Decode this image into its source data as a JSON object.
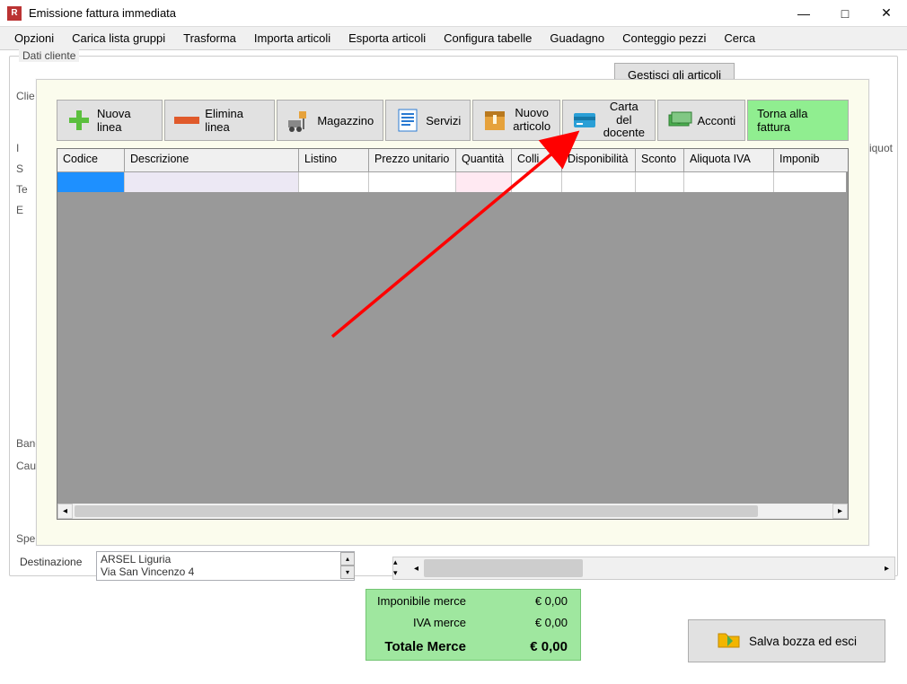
{
  "window": {
    "title": "Emissione fattura immediata",
    "app_icon_text": "R"
  },
  "menu": {
    "items": [
      "Opzioni",
      "Carica lista gruppi",
      "Trasforma",
      "Importa articoli",
      "Esporta articoli",
      "Configura tabelle",
      "Guadagno",
      "Conteggio pezzi",
      "Cerca"
    ]
  },
  "bg": {
    "group_title": "Dati cliente",
    "labels": {
      "clie": "Clie",
      "i": "I",
      "s": "S",
      "te": "Te",
      "e": "E",
      "banca": "Banca",
      "caus": "Caus",
      "spe": "Spe",
      "aliquot": "Aliquot"
    },
    "gestisci": "Gestisci gli articoli",
    "dest_label": "Destinazione",
    "dest_line1": "ARSEL Liguria",
    "dest_line2": "Via San Vincenzo 4"
  },
  "toolbar": {
    "nuova_linea": "Nuova linea",
    "elimina_linea": "Elimina linea",
    "magazzino": "Magazzino",
    "servizi": "Servizi",
    "nuovo_articolo": "Nuovo\narticolo",
    "carta_docente": "Carta del\ndocente",
    "acconti": "Acconti",
    "torna": "Torna alla fattura"
  },
  "grid": {
    "headers": [
      "Codice",
      "Descrizione",
      "Listino",
      "Prezzo unitario",
      "Quantità",
      "Colli",
      "Disponibilità",
      "Sconto",
      "Aliquota IVA",
      "Imponib"
    ]
  },
  "totals": {
    "imponibile_label": "Imponibile merce",
    "imponibile_value": "€ 0,00",
    "iva_label": "IVA merce",
    "iva_value": "€ 0,00",
    "tot_label": "Totale Merce",
    "tot_value": "€ 0,00"
  },
  "save": {
    "label": "Salva bozza ed esci"
  }
}
